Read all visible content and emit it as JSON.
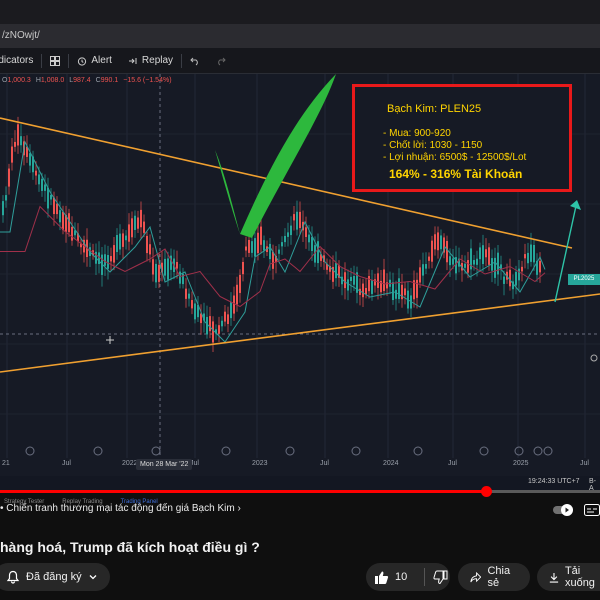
{
  "browser": {
    "url_fragment": "/zNOwjt/"
  },
  "toolbar": {
    "indicators": "Indicators",
    "alert": "Alert",
    "replay": "Replay"
  },
  "ohlc": {
    "open_label": "O",
    "open": "1,000.3",
    "high_label": "H",
    "high": "1,008.0",
    "low_label": "L",
    "low": "987.4",
    "close_label": "C",
    "close": "990.1",
    "change": "−15.6 (−1.54%)"
  },
  "annotation": {
    "title": "Bạch Kim:  PLEN25",
    "buy": "- Mua: 900-920",
    "take_profit": "- Chốt lời: 1030 - 1150",
    "profit": "- Lợi nhuận: 6500$ - 12500$/Lot",
    "return": "164% - 316% Tài Khoản",
    "border_color": "#e8191a",
    "text_color": "#ffd400"
  },
  "price_badge": "PL2025",
  "chart_data": {
    "type": "candlestick",
    "description_free": true,
    "x_tick_labels": [
      "21",
      "Jul",
      "2022",
      "Jul",
      "2023",
      "Jul",
      "2024",
      "Jul",
      "2025",
      "Jul"
    ],
    "crosshair_date": "Mon 28 Mar '22",
    "colors": {
      "up": "#26a69a",
      "down": "#ef5350",
      "trendline": "#f0a030",
      "check": "#2db83d",
      "arrow": "#2ec4a8"
    }
  },
  "status": {
    "clock": "19:24:33 UTC+7",
    "scale": "B-A"
  },
  "tabs": [
    "Strategy Tester",
    "Replay Trading",
    "Trading Panel"
  ],
  "player": {
    "chapter": "• Chiến tranh thương mại tác động đến giá Bạch Kim  ›",
    "progress_fraction": 0.81
  },
  "video": {
    "title": "hàng hoá, Trump đã kích hoạt điều gì ?",
    "subscribed": "Đã đăng ký",
    "likes": "10",
    "share": "Chia sẻ",
    "download": "Tải xuống"
  }
}
